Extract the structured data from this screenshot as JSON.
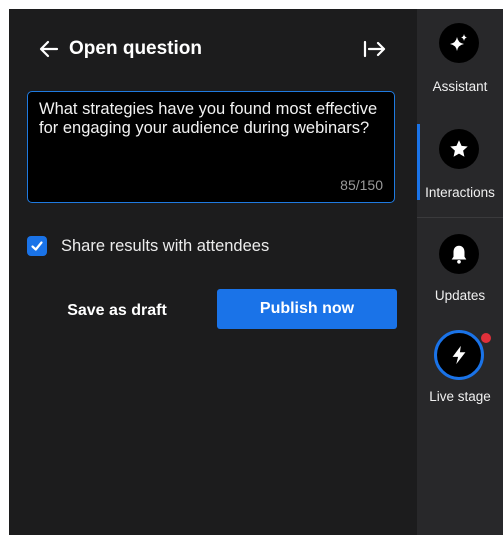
{
  "header": {
    "title": "Open question"
  },
  "question": {
    "text": "What strategies have you found most effective for engaging your audience during webinars?",
    "char_count": "85/150"
  },
  "share": {
    "checked": true,
    "label": "Share results with attendees"
  },
  "actions": {
    "draft_label": "Save as draft",
    "publish_label": "Publish now"
  },
  "rail": {
    "items": [
      {
        "label": "Assistant",
        "icon": "sparkle-icon"
      },
      {
        "label": "Interactions",
        "icon": "star-icon"
      },
      {
        "label": "Updates",
        "icon": "bell-icon"
      },
      {
        "label": "Live stage",
        "icon": "lightning-icon"
      }
    ]
  },
  "colors": {
    "panel_bg": "#1c1c1d",
    "rail_bg": "#28282a",
    "accent": "#1a73e8",
    "notification": "#e0303a"
  }
}
